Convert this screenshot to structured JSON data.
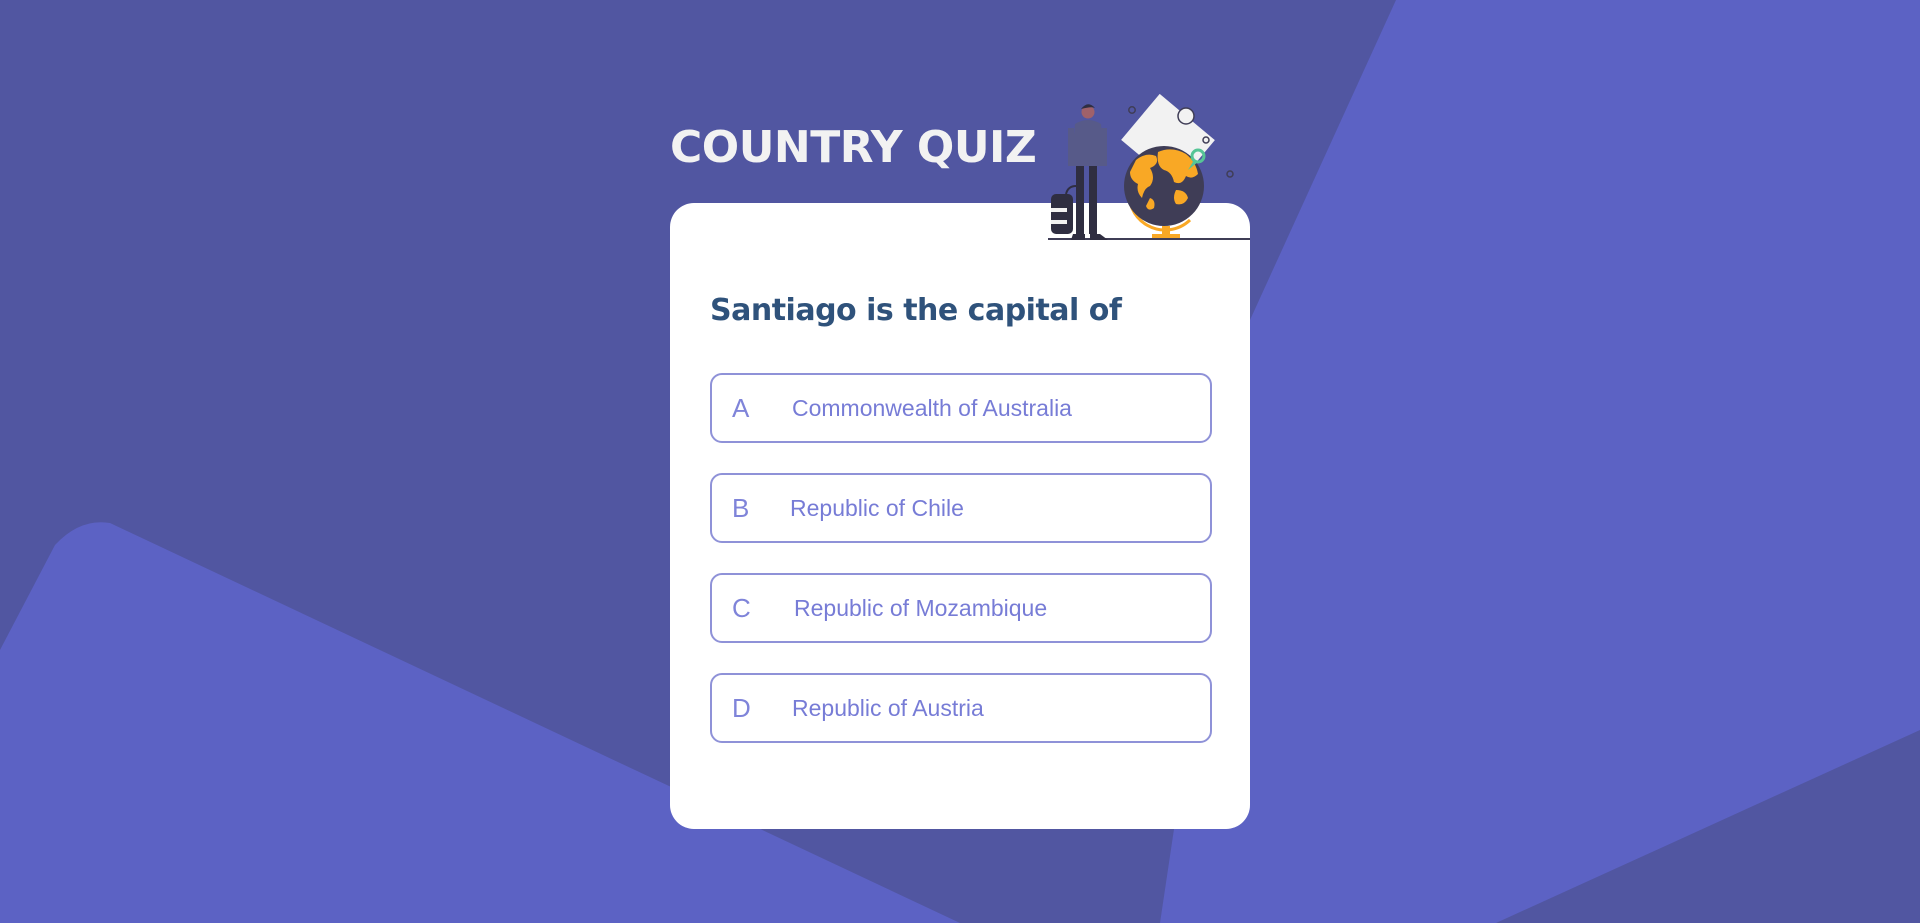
{
  "app": {
    "title": "COUNTRY QUIZ"
  },
  "quiz": {
    "question": "Santiago is the capital of",
    "options": [
      {
        "letter": "A",
        "label": "Commonwealth of Australia"
      },
      {
        "letter": "B",
        "label": "Republic of Chile"
      },
      {
        "letter": "C",
        "label": "Republic of Mozambique"
      },
      {
        "letter": "D",
        "label": "Republic of Austria"
      }
    ]
  },
  "theme": {
    "background": "#5156a1",
    "background_shape": "#5c62c4",
    "card": "#ffffff",
    "title_color": "#f2f2f2",
    "question_color": "#2f527b",
    "option_accent": "#6066d0",
    "option_border": "#8f92d8"
  },
  "icons": {
    "illustration": "traveler-with-globe-illustration"
  }
}
